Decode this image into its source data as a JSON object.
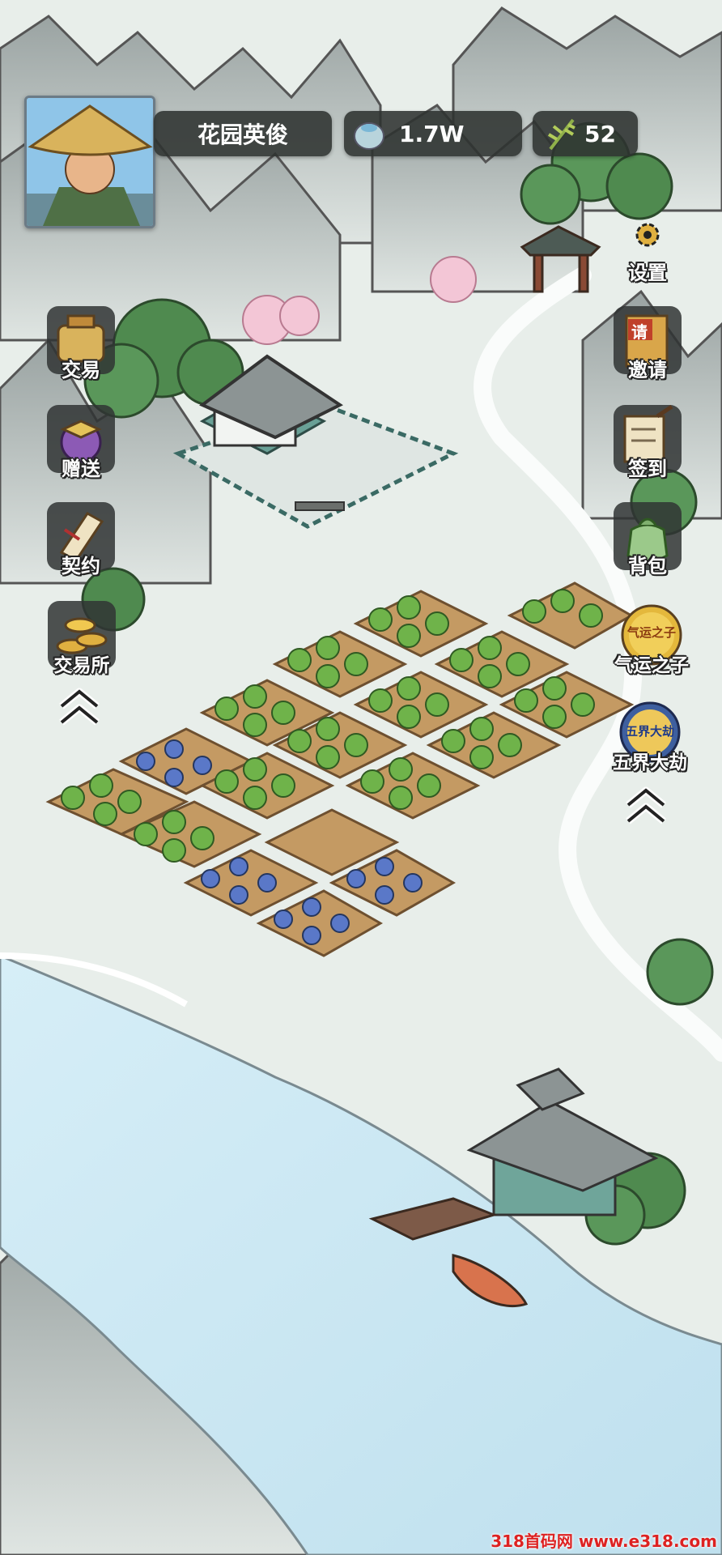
{
  "player": {
    "name": "花园英俊",
    "gold": "1.7W",
    "energy": "52"
  },
  "left_menu": {
    "trade": "交易",
    "gift": "赠送",
    "contract": "契约",
    "exchange": "交易所"
  },
  "right_menu": {
    "settings": "设置",
    "invite": "邀请",
    "checkin": "签到",
    "bag": "背包",
    "fortune": "气运之子",
    "fortune_badge": "气运之子",
    "calamity": "五界大劫",
    "calamity_badge": "五界大劫",
    "invite_badge": "请"
  },
  "watermark": "318首码网 www.e318.com",
  "colors": {
    "panel": "#2d3230",
    "water": "#cfe9f3",
    "soil": "#c49a63",
    "leaf": "#6fb34a"
  }
}
